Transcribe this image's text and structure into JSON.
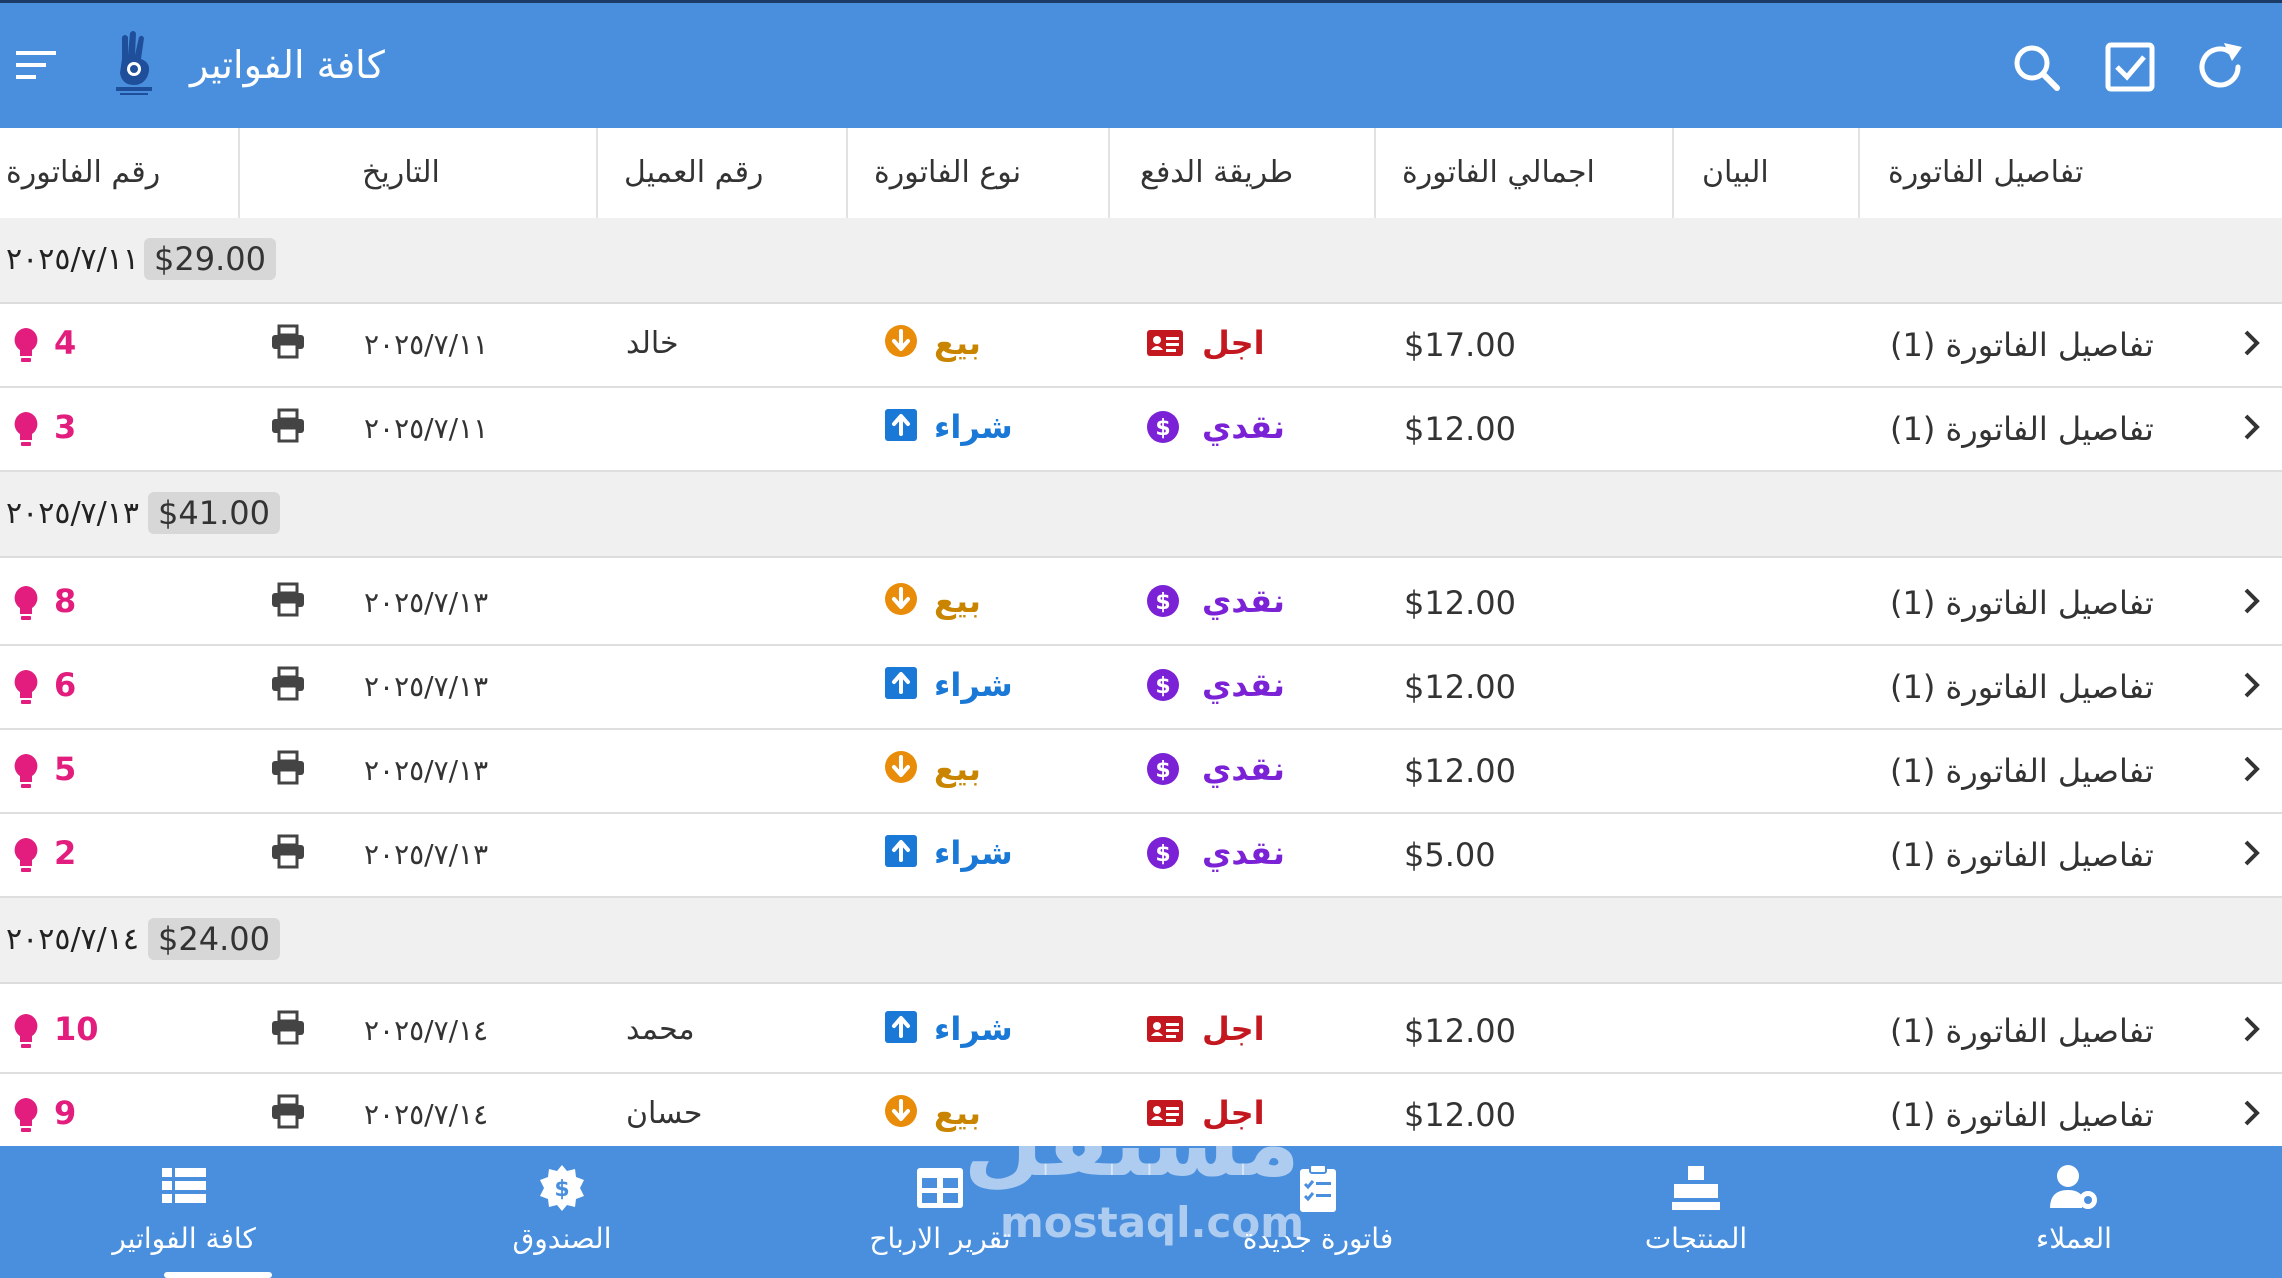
{
  "appbar": {
    "title": "كافة الفواتير"
  },
  "columns": [
    "رقم الفاتورة",
    "التاريخ",
    "رقم العميل",
    "نوع الفاتورة",
    "طريقة الدفع",
    "اجمالي الفاتورة",
    "البيان",
    "تفاصيل الفاتورة"
  ],
  "groups": [
    {
      "date": "٢٠٢٥/٧/١١",
      "total": "$29.00"
    },
    {
      "date": "٢٠٢٥/٧/١٣",
      "total": "$41.00"
    },
    {
      "date": "٢٠٢٥/٧/١٤",
      "total": "$24.00"
    }
  ],
  "rows": [
    {
      "num": "4",
      "date": "٢٠٢٥/٧/١١",
      "customer": "خالد",
      "type": "بيع",
      "payment": "اجل",
      "amount": "$17.00",
      "details": "تفاصيل الفاتورة (1)"
    },
    {
      "num": "3",
      "date": "٢٠٢٥/٧/١١",
      "customer": "",
      "type": "شراء",
      "payment": "نقدي",
      "amount": "$12.00",
      "details": "تفاصيل الفاتورة (1)"
    },
    {
      "num": "8",
      "date": "٢٠٢٥/٧/١٣",
      "customer": "",
      "type": "بيع",
      "payment": "نقدي",
      "amount": "$12.00",
      "details": "تفاصيل الفاتورة (1)"
    },
    {
      "num": "6",
      "date": "٢٠٢٥/٧/١٣",
      "customer": "",
      "type": "شراء",
      "payment": "نقدي",
      "amount": "$12.00",
      "details": "تفاصيل الفاتورة (1)"
    },
    {
      "num": "5",
      "date": "٢٠٢٥/٧/١٣",
      "customer": "",
      "type": "بيع",
      "payment": "نقدي",
      "amount": "$12.00",
      "details": "تفاصيل الفاتورة (1)"
    },
    {
      "num": "2",
      "date": "٢٠٢٥/٧/١٣",
      "customer": "",
      "type": "شراء",
      "payment": "نقدي",
      "amount": "$5.00",
      "details": "تفاصيل الفاتورة (1)"
    },
    {
      "num": "10",
      "date": "٢٠٢٥/٧/١٤",
      "customer": "محمد",
      "type": "شراء",
      "payment": "اجل",
      "amount": "$12.00",
      "details": "تفاصيل الفاتورة (1)"
    },
    {
      "num": "9",
      "date": "٢٠٢٥/٧/١٤",
      "customer": "حسان",
      "type": "بيع",
      "payment": "اجل",
      "amount": "$12.00",
      "details": "تفاصيل الفاتورة (1)"
    }
  ],
  "bottom_nav": [
    {
      "label": "كافة الفواتير",
      "icon": "list-icon",
      "active": true
    },
    {
      "label": "الصندوق",
      "icon": "cashbox-icon"
    },
    {
      "label": "تقرير الارباح",
      "icon": "report-grid-icon"
    },
    {
      "label": "فاتورة جديدة",
      "icon": "clipboard-icon"
    },
    {
      "label": "المنتجات",
      "icon": "products-icon"
    },
    {
      "label": "العملاء",
      "icon": "user-gear-icon"
    }
  ],
  "watermark": {
    "arabic": "مستقل",
    "latin": "mostaql.com"
  },
  "colors": {
    "primary": "#4a8fdd",
    "invoice_number": "#e21d7d",
    "sale": "#c98400",
    "sale_icon": "#e88c0a",
    "purchase": "#1a78d6",
    "cash": "#7b22d6",
    "credit": "#c41820"
  }
}
